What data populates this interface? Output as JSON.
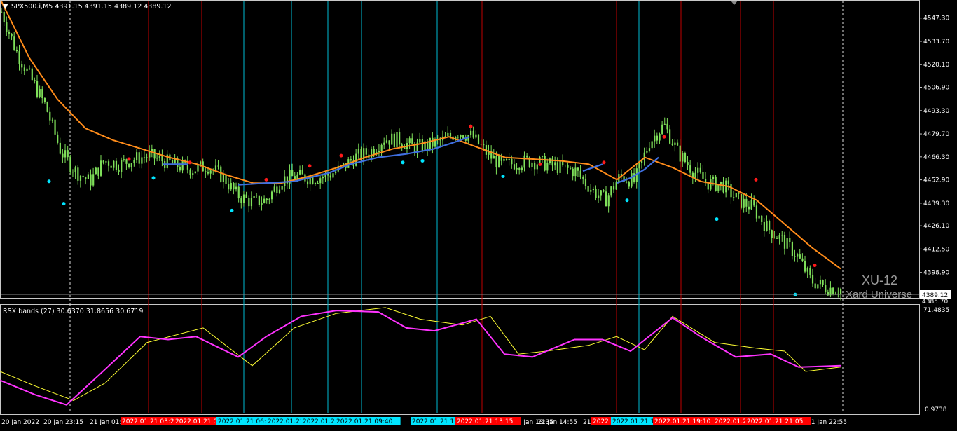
{
  "main": {
    "symbol_header": "SPX500.i,M5  4391.15 4391.15 4389.12 4389.12",
    "price_levels": [
      "4547.30",
      "4533.70",
      "4520.10",
      "4506.90",
      "4493.30",
      "4479.70",
      "4466.30",
      "4452.90",
      "4439.30",
      "4426.10",
      "4412.50",
      "4398.90",
      "4385.70"
    ],
    "price_range": [
      4382,
      4557
    ],
    "current_price": "4389.12",
    "watermark_title": "XU-12",
    "watermark_sub": "Xard Universe"
  },
  "indicator": {
    "label": "RSX bands (27) 30.6370 31.8656 30.6719",
    "top_value": "71.4835",
    "bottom_value": "0.9738",
    "range": [
      0.9738,
      71.4835
    ]
  },
  "time_axis": {
    "labels": [
      "20 Jan 2022",
      "20 Jan 23:15",
      "21 Jan 01:",
      "21 Jan 13:35",
      "21 Jan 14:55",
      "21",
      "21 Jan 22:55"
    ]
  },
  "time_tags": [
    {
      "text": "2022.01.21 03:20",
      "color": "#ff0000"
    },
    {
      "text": "2022.01.21 0",
      "color": "#ff0000"
    },
    {
      "text": "2022.01.21 06:",
      "color": "#00e5ff"
    },
    {
      "text": "2022.01.21",
      "color": "#00e5ff"
    },
    {
      "text": "2022.01.21",
      "color": "#00e5ff"
    },
    {
      "text": "2022.01.21 09:40",
      "color": "#00e5ff"
    },
    {
      "text": "2022.01.21 11",
      "color": "#00e5ff"
    },
    {
      "text": "2022.01.21 13:15",
      "color": "#ff0000"
    },
    {
      "text": "2022.",
      "color": "#ff0000"
    },
    {
      "text": "2022.01.21 1",
      "color": "#00e5ff"
    },
    {
      "text": "2022.01.21 19:10",
      "color": "#ff0000"
    },
    {
      "text": "2022.01.2",
      "color": "#ff0000"
    },
    {
      "text": "2022.01.21 21:05",
      "color": "#ff0000"
    }
  ],
  "colors": {
    "background": "#000000",
    "candle": "#7fe05a",
    "slow_ma": "#ff8c1a",
    "fast_ma": "#3f6fe0",
    "red_line": "#c00000",
    "cyan_line": "#00bcd4",
    "rsx_main": "#ff33ff",
    "rsx_band": "#ffff33",
    "dot_up": "#00e5ff",
    "dot_down": "#ff1a1a"
  },
  "chart_data": {
    "type": "line",
    "series": [
      {
        "name": "price_close",
        "values": [
          4551,
          4528,
          4512,
          4496,
          4470,
          4458,
          4452,
          4464,
          4462,
          4465,
          4467,
          4464,
          4461,
          4459,
          4461,
          4455,
          4444,
          4440,
          4441,
          4453,
          4455,
          4454,
          4455,
          4459,
          4466,
          4469,
          4477,
          4476,
          4472,
          4473,
          4476,
          4481,
          4478,
          4468,
          4461,
          4463,
          4464,
          4462,
          4460,
          4458,
          4448,
          4441,
          4455,
          4452,
          4475,
          4485,
          4468,
          4458,
          4451,
          4450,
          4441,
          4437,
          4425,
          4418,
          4409,
          4394,
          4390,
          4389
        ]
      },
      {
        "name": "ma_slow",
        "values": [
          4557,
          4524,
          4500,
          4483,
          4476,
          4471,
          4466,
          4462,
          4456,
          4451,
          4451,
          4455,
          4460,
          4466,
          4471,
          4474,
          4478,
          4472,
          4466,
          4465,
          4464,
          4462,
          4453,
          4466,
          4460,
          4452,
          4449,
          4441,
          4427,
          4413,
          4401
        ]
      }
    ]
  }
}
